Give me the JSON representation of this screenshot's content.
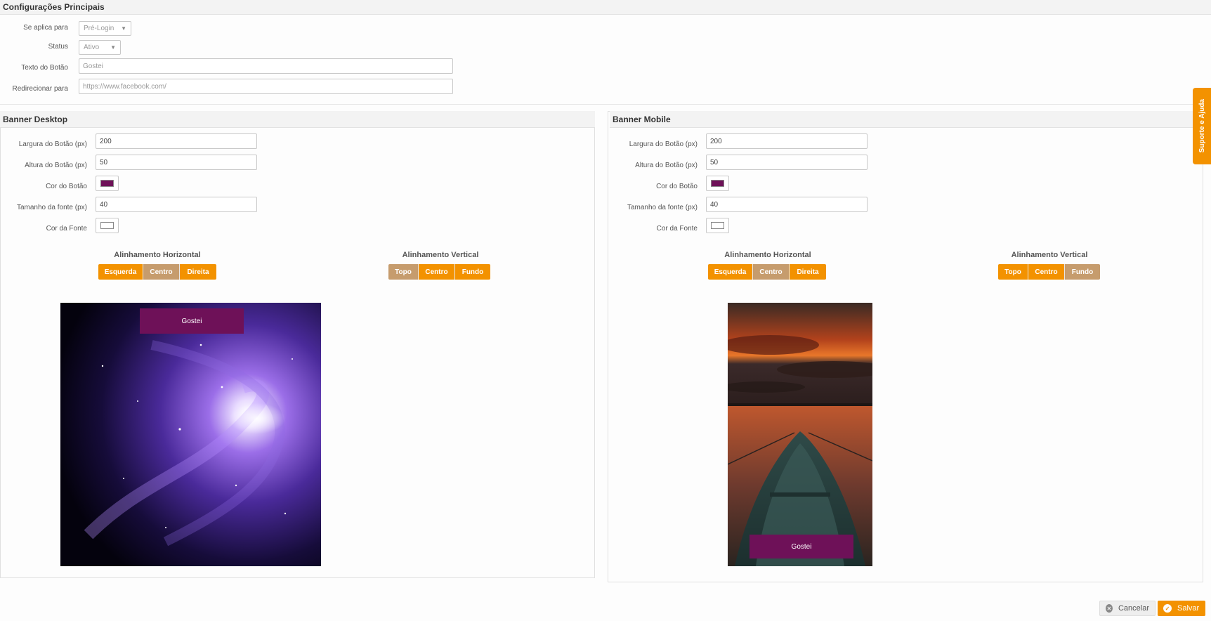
{
  "main": {
    "title": "Configurações Principais",
    "applies_label": "Se aplica para",
    "applies_value": "Pré-Login",
    "status_label": "Status",
    "status_value": "Ativo",
    "button_text_label": "Texto do Botão",
    "button_text_value": "Gostei",
    "redirect_label": "Redirecionar para",
    "redirect_value": "https://www.facebook.com/"
  },
  "desktop": {
    "title": "Banner Desktop",
    "width_label": "Largura do Botão (px)",
    "width_value": "200",
    "height_label": "Altura do Botão (px)",
    "height_value": "50",
    "button_color_label": "Cor do Botão",
    "button_color": "#6e1158",
    "font_size_label": "Tamanho da fonte (px)",
    "font_size_value": "40",
    "font_color_label": "Cor da Fonte",
    "font_color": "#ffffff",
    "h_align_title": "Alinhamento Horizontal",
    "h_align": [
      "Esquerda",
      "Centro",
      "Direita"
    ],
    "h_align_selected": "Centro",
    "v_align_title": "Alinhamento Vertical",
    "v_align": [
      "Topo",
      "Centro",
      "Fundo"
    ],
    "v_align_selected": "Topo",
    "preview_button": "Gostei"
  },
  "mobile": {
    "title": "Banner Mobile",
    "width_label": "Largura do Botão (px)",
    "width_value": "200",
    "height_label": "Altura do Botão (px)",
    "height_value": "50",
    "button_color_label": "Cor do Botão",
    "button_color": "#6e1158",
    "font_size_label": "Tamanho da fonte (px)",
    "font_size_value": "40",
    "font_color_label": "Cor da Fonte",
    "font_color": "#ffffff",
    "h_align_title": "Alinhamento Horizontal",
    "h_align": [
      "Esquerda",
      "Centro",
      "Direita"
    ],
    "h_align_selected": "Centro",
    "v_align_title": "Alinhamento Vertical",
    "v_align": [
      "Topo",
      "Centro",
      "Fundo"
    ],
    "v_align_selected": "Fundo",
    "preview_button": "Gostei"
  },
  "footer": {
    "cancel_label": "Cancelar",
    "save_label": "Salvar"
  },
  "help_tab": "Suporte e Ajuda",
  "colors": {
    "accent": "#f39200",
    "active_segment": "#c69c6d",
    "button_color": "#6e1158"
  }
}
